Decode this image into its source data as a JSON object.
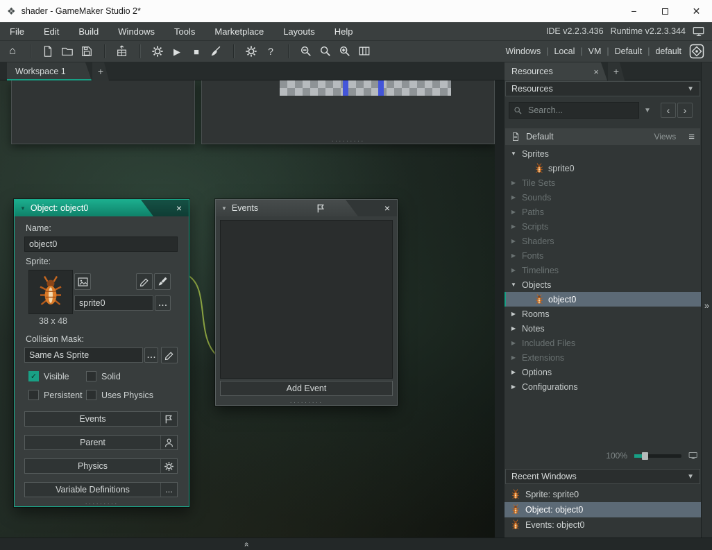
{
  "window": {
    "title": "shader - GameMaker Studio 2*"
  },
  "menu_bar": {
    "items": [
      "File",
      "Edit",
      "Build",
      "Windows",
      "Tools",
      "Marketplace",
      "Layouts",
      "Help"
    ],
    "ide_version": "IDE v2.2.3.436",
    "runtime_version": "Runtime v2.2.3.344"
  },
  "toolbar": {
    "targets": [
      "Windows",
      "Local",
      "VM",
      "Default",
      "default"
    ]
  },
  "workspace_tabs": {
    "active": "Workspace 1",
    "new_tab": "+"
  },
  "object_window": {
    "title": "Object: object0",
    "name_label": "Name:",
    "name_value": "object0",
    "sprite_label": "Sprite:",
    "sprite_name": "sprite0",
    "sprite_dots": "...",
    "sprite_size": "38 x 48",
    "collision_label": "Collision Mask:",
    "collision_value": "Same As Sprite",
    "collision_dots": "...",
    "variables_dots": "...",
    "checkboxes": {
      "visible": "Visible",
      "visible_checked": true,
      "solid": "Solid",
      "solid_checked": false,
      "persistent": "Persistent",
      "persistent_checked": false,
      "uses_physics": "Uses Physics",
      "uses_physics_checked": false
    },
    "action_buttons": {
      "events": "Events",
      "parent": "Parent",
      "physics": "Physics",
      "variables": "Variable Definitions"
    }
  },
  "events_window": {
    "title": "Events",
    "add_button": "Add Event"
  },
  "resources_panel": {
    "tab": "Resources",
    "new_tab": "+",
    "dropdown_label": "Resources",
    "search_placeholder": "Search...",
    "default_row": {
      "label": "Default",
      "views_label": "Views"
    },
    "tree": [
      {
        "label": "Sprites",
        "classes": "group expanded"
      },
      {
        "label": "sprite0",
        "classes": "child icon-bug"
      },
      {
        "label": "Tile Sets",
        "classes": "group collapsed disabled"
      },
      {
        "label": "Sounds",
        "classes": "group collapsed disabled"
      },
      {
        "label": "Paths",
        "classes": "group collapsed disabled"
      },
      {
        "label": "Scripts",
        "classes": "group collapsed disabled"
      },
      {
        "label": "Shaders",
        "classes": "group collapsed disabled"
      },
      {
        "label": "Fonts",
        "classes": "group collapsed disabled"
      },
      {
        "label": "Timelines",
        "classes": "group collapsed disabled"
      },
      {
        "label": "Objects",
        "classes": "group expanded"
      },
      {
        "label": "object0",
        "classes": "child icon-bug selected"
      },
      {
        "label": "Rooms",
        "classes": "group collapsed"
      },
      {
        "label": "Notes",
        "classes": "group collapsed"
      },
      {
        "label": "Included Files",
        "classes": "group collapsed disabled"
      },
      {
        "label": "Extensions",
        "classes": "group collapsed disabled"
      },
      {
        "label": "Options",
        "classes": "group collapsed"
      },
      {
        "label": "Configurations",
        "classes": "group collapsed"
      }
    ],
    "zoom_value": "100%",
    "recent_header": "Recent Windows",
    "recent": [
      {
        "label": "Sprite: sprite0",
        "classes": "icon-bug"
      },
      {
        "label": "Object: object0",
        "classes": "icon-bug selected"
      },
      {
        "label": "Events: object0",
        "classes": "icon-bug"
      }
    ]
  }
}
